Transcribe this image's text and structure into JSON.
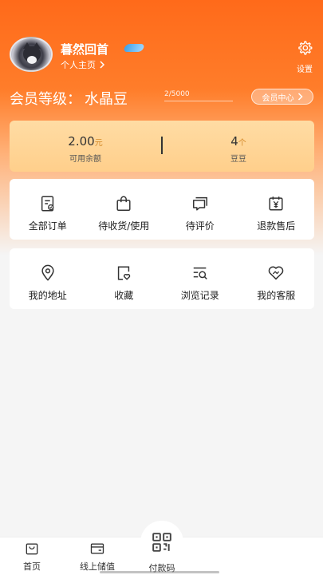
{
  "user": {
    "name": "暮然回首",
    "profile_link": "个人主页",
    "settings_label": "设置"
  },
  "membership": {
    "level_label": "会员等级：",
    "level_name": "水晶豆",
    "progress_text": "2/5000",
    "progress_fraction": 0.0004,
    "center_label": "会员中心"
  },
  "wallet": {
    "balance_value": "2.00",
    "balance_unit": "元",
    "balance_label": "可用余额",
    "beans_value": "4",
    "beans_unit": "个",
    "beans_label": "豆豆"
  },
  "orders": [
    {
      "label": "全部订单",
      "icon": "order-list-icon"
    },
    {
      "label": "待收货/使用",
      "icon": "shopping-bag-icon"
    },
    {
      "label": "待评价",
      "icon": "comment-icon"
    },
    {
      "label": "退款售后",
      "icon": "refund-icon"
    }
  ],
  "tools": [
    {
      "label": "我的地址",
      "icon": "location-icon"
    },
    {
      "label": "收藏",
      "icon": "favorite-icon"
    },
    {
      "label": "浏览记录",
      "icon": "history-icon"
    },
    {
      "label": "我的客服",
      "icon": "service-icon"
    }
  ],
  "tabbar": {
    "home": "首页",
    "stored_value": "线上储值",
    "pay_code": "付款码"
  },
  "colors": {
    "accent": "#ff6a1a",
    "wallet_bg": "#ffd596"
  }
}
